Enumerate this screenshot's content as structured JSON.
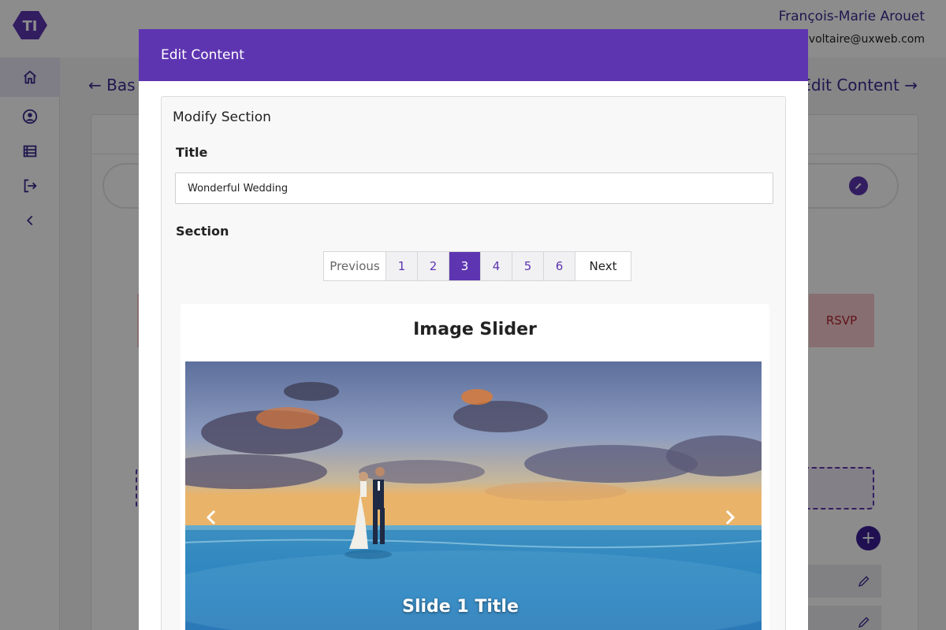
{
  "header": {
    "user_name": "François-Marie Arouet",
    "user_email": "voltaire@uxweb.com"
  },
  "breadcrumb": {
    "back_label": "← Bas",
    "forward_label": "Edit Content →"
  },
  "background": {
    "rsvp_label": "RSVP"
  },
  "modal": {
    "title": "Edit Content",
    "section_title": "Modify Section",
    "title_label": "Title",
    "title_value": "Wonderful Wedding",
    "section_label": "Section",
    "pagination": {
      "previous": "Previous",
      "pages": [
        "1",
        "2",
        "3",
        "4",
        "5",
        "6"
      ],
      "active_page": "3",
      "next": "Next"
    },
    "slider": {
      "heading": "Image Slider",
      "caption": "Slide 1 Title"
    }
  },
  "colors": {
    "brand": "#5e35b1",
    "brand_dark": "#3b2a8f",
    "rsvp_bg": "#f6c8cc",
    "rsvp_text": "#b02331"
  },
  "icons": [
    "home-icon",
    "user-icon",
    "list-icon",
    "logout-icon",
    "chevron-left-icon",
    "pencil-icon",
    "plus-icon",
    "chevron-right-icon"
  ]
}
